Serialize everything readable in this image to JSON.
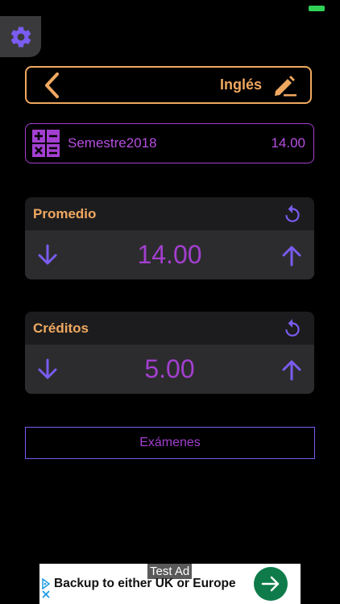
{
  "subject": {
    "name": "Inglés"
  },
  "semester": {
    "name": "Semestre2018",
    "value": "14.00"
  },
  "average": {
    "title": "Promedio",
    "value": "14.00"
  },
  "credits": {
    "title": "Créditos",
    "value": "5.00"
  },
  "exams_button": {
    "label": "Exámenes"
  },
  "ad": {
    "tag": "Test Ad",
    "text": "Backup to either UK or Europe"
  },
  "colors": {
    "accent_orange": "#f0a860",
    "accent_purple": "#a33fd0",
    "arrow_violet": "#7a5cf0",
    "status_green": "#31d158"
  },
  "icons": [
    "gear-icon",
    "back-chevron-icon",
    "edit-pencil-icon",
    "calculator-icon",
    "reset-icon",
    "arrow-down-icon",
    "arrow-up-icon",
    "arrow-right-icon",
    "adchoices-icon",
    "close-icon"
  ]
}
